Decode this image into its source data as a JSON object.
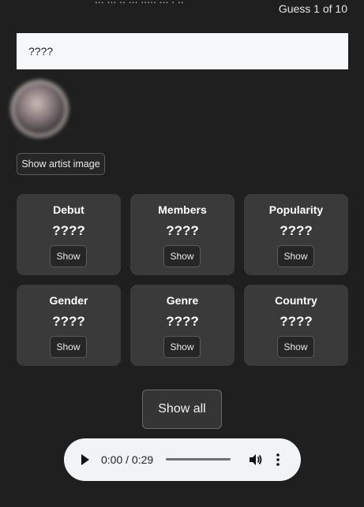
{
  "header": {
    "cut_text": "... ...   .. ... .....   ... . ..",
    "guess_counter": "Guess 1 of 10"
  },
  "answer": {
    "value": "????"
  },
  "artist_image": {
    "button_label": "Show artist image"
  },
  "cards": [
    {
      "title": "Debut",
      "value": "????",
      "button": "Show"
    },
    {
      "title": "Members",
      "value": "????",
      "button": "Show"
    },
    {
      "title": "Popularity",
      "value": "????",
      "button": "Show"
    },
    {
      "title": "Gender",
      "value": "????",
      "button": "Show"
    },
    {
      "title": "Genre",
      "value": "????",
      "button": "Show"
    },
    {
      "title": "Country",
      "value": "????",
      "button": "Show"
    }
  ],
  "show_all": {
    "label": "Show all"
  },
  "audio": {
    "time": "0:00 / 0:29",
    "icons": [
      "play-icon",
      "volume-icon",
      "more-options-icon"
    ]
  },
  "colors": {
    "background": "#1f1f1f",
    "card": "#3a3a3a",
    "answer_box": "#f7f8fa",
    "audio_player": "#f1f3f4"
  }
}
